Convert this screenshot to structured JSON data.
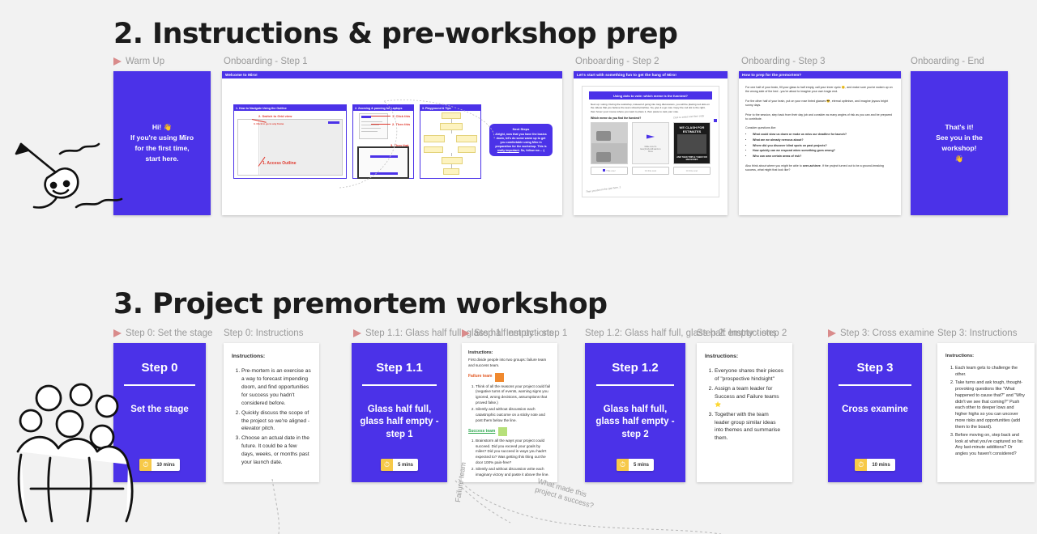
{
  "sections": {
    "two": {
      "title": "2. Instructions & pre-workshop prep",
      "labels": {
        "warmup": "Warm Up",
        "step1": "Onboarding - Step 1",
        "step2": "Onboarding - Step 2",
        "step3": "Onboarding - Step 3",
        "end": "Onboarding - End"
      }
    },
    "three": {
      "title": "3. Project premortem workshop",
      "labels": {
        "step0": "Step 0: Set the stage",
        "step0_instructions": "Step 0: Instructions",
        "step11": "Step 1.1: Glass half full, glass half empty - step 1",
        "step1_instructions": "Step 1: Instructions",
        "step12": "Step 1.2: Glass half full, glass half empty - step 2",
        "step2_instructions": "Step 2: Instructions",
        "step3": "Step 3: Cross examine",
        "step3_instructions": "Step 3: Instructions"
      }
    }
  },
  "warmup_card": {
    "line1": "Hi! 👋",
    "line2": "If you're using Miro",
    "line3": "for the first time,",
    "line4": "start here."
  },
  "end_card": {
    "line1": "That's it!",
    "line2": "See you in the",
    "line3": "workshop!",
    "line4": "👋"
  },
  "onboarding_step1": {
    "header": "Welcome to Miro!",
    "cards": [
      {
        "title": "1. How to Navigate Using the Outline",
        "annotations": [
          "1. Access Outline",
          "2. Switch to Grid view",
          "3. Click to go to any frame"
        ]
      },
      {
        "title": "2. Zooming & panning for Laptops",
        "annotations": [
          "1. Click this",
          "2. Then this",
          "3. Then that"
        ]
      },
      {
        "title": "3. Playground & Tips",
        "annotations": []
      }
    ],
    "next_steps": {
      "heading": "Next Steps",
      "body_1": "Alright, now that you have the basics down, let's do some warm up to get you comfortable using Miro in preparation for the workshop. This is ",
      "emphasis": "really important",
      "body_2": ". So, follow me... :)"
    }
  },
  "onboarding_step2": {
    "header": "Let's start with something fun to get the hang of Miro!",
    "banner": "Using dots to vote: which meme is the funniest?",
    "paragraph": "Next up: voting. During the workshop, instead of going into long discussions, you will be placing red dots on the videos that you believe the team should prioritise. So, give it a go now. Copy the rod dot to the right, then hover your mouse where you want to place it, then paste to cast your vote.",
    "question": "Which meme do you find the funniest?",
    "memes": [
      {
        "caption": "",
        "style": "photo"
      },
      {
        "caption": "",
        "style": "plain"
      },
      {
        "caption_top": "WE CLASH FOR ESTIMATES",
        "caption_bottom": "AND THEN TRIPLE THEM FOR MEASURES",
        "style": "dark"
      }
    ],
    "vote_labels": [
      "This one!",
      "Or this one!",
      "Or this one!"
    ],
    "hand_notes": [
      "Click to select and then copy",
      "Then you dot on the spot here. :)"
    ]
  },
  "onboarding_step3": {
    "header": "How to prep for the premortem?",
    "paragraphs": [
      "For one half of your brain, fill your glass to half empty, call your inner cynic 😐, and make sure you've woken up on the wrong side of the bed - you're about to imagine your own tragic end.",
      "For the other half of your brain, put on your rose tinted glasses 😎, eternal optimism, and imagine joyous bright sunny days.",
      "Prior to the session, step back from their day job and consider as many angles of risk as you can and be prepared to contribute."
    ],
    "consider_label": "Consider questions like:",
    "bullets": [
      "What could slow us down or make us miss our deadline for launch?",
      "What are we already nervous about?",
      "Where did you discover blind spots on past projects?",
      "How quickly can we respond when something goes wrong?",
      "Who can own certain areas of risk?"
    ],
    "closing_1": "Also think about where you might be able to ",
    "closing_emphasis": "over-achieve",
    "closing_2": ". If the project turned out to be a ground-breaking success, what might that look like?"
  },
  "workshop_cards": [
    {
      "title": "Step 0",
      "subtitle": "Set the stage",
      "timer": "10 mins"
    },
    {
      "title": "Step 1.1",
      "subtitle": "Glass half full, glass half empty - step 1",
      "timer": "5 mins"
    },
    {
      "title": "Step 1.2",
      "subtitle": "Glass half full, glass half empty - step 2",
      "timer": "5 mins"
    },
    {
      "title": "Step 3",
      "subtitle": "Cross examine",
      "timer": "10 mins"
    }
  ],
  "notes": {
    "step0": {
      "heading": "Instructions:",
      "items": [
        "Pre-mortem is an exercise as a way to forecast impending doom, and find opportunities for success you hadn't considered before.",
        "Quickly discuss the scope of the project so we're aligned - elevator pitch.",
        "Choose an actual date in the future. It could be a few days, weeks, or months past your launch date."
      ]
    },
    "step1": {
      "heading": "Instructions:",
      "intro": "First divide people into two groups: failure team and success team.",
      "failure_label": "Failure team",
      "failure_items": [
        "Think of all the reasons your project could fail (negative turns of events, warning signs you ignored, wrong decisions, assumptions that proved false.)",
        "Silently and without discussion each catastrophic outcome on a sticky note and post them below the line."
      ],
      "success_label": "Success team",
      "success_items": [
        "Brainstorm all the ways your project could succeed. Did you exceed your goals by miles? Did you succeed in ways you hadn't expected to? Was getting this thing out the door 100% pain-free?",
        "Silently and without discussion write each imaginary victory and paste it above the line."
      ]
    },
    "step2": {
      "heading": "Instructions:",
      "items": [
        "Everyone shares their pieces of \"prospective hindsight\"",
        "Assign a team leader for Success and Failure teams ⭐",
        "Together with the team leader group similar ideas into themes and summarise them."
      ]
    },
    "step3": {
      "heading": "Instructions:",
      "items": [
        "Each team gets to challenge the other.",
        "Take turns and ask tough, thought-provoking questions like \"What happened to cause that?\" and \"Why didn't we see that coming?\" Push each other to deeper lows and higher highs so you can uncover more risks and opportunities (add them to the board).",
        "Before moving on, step back and look at what you've captured so far. Any last-minute additions? Or angles you haven't considered?"
      ]
    }
  },
  "canvas_notes": {
    "failure_line": "Failure team",
    "success_question": "What made this\nproject a success?"
  },
  "colors": {
    "brand_blue": "#4b32e8",
    "background": "#f2f2f2",
    "label_grey": "#9a9a9a",
    "flag_red": "#d98b8b",
    "failure_orange": "#e25822",
    "success_green": "#2fa84f",
    "timer_yellow": "#f7c948"
  }
}
